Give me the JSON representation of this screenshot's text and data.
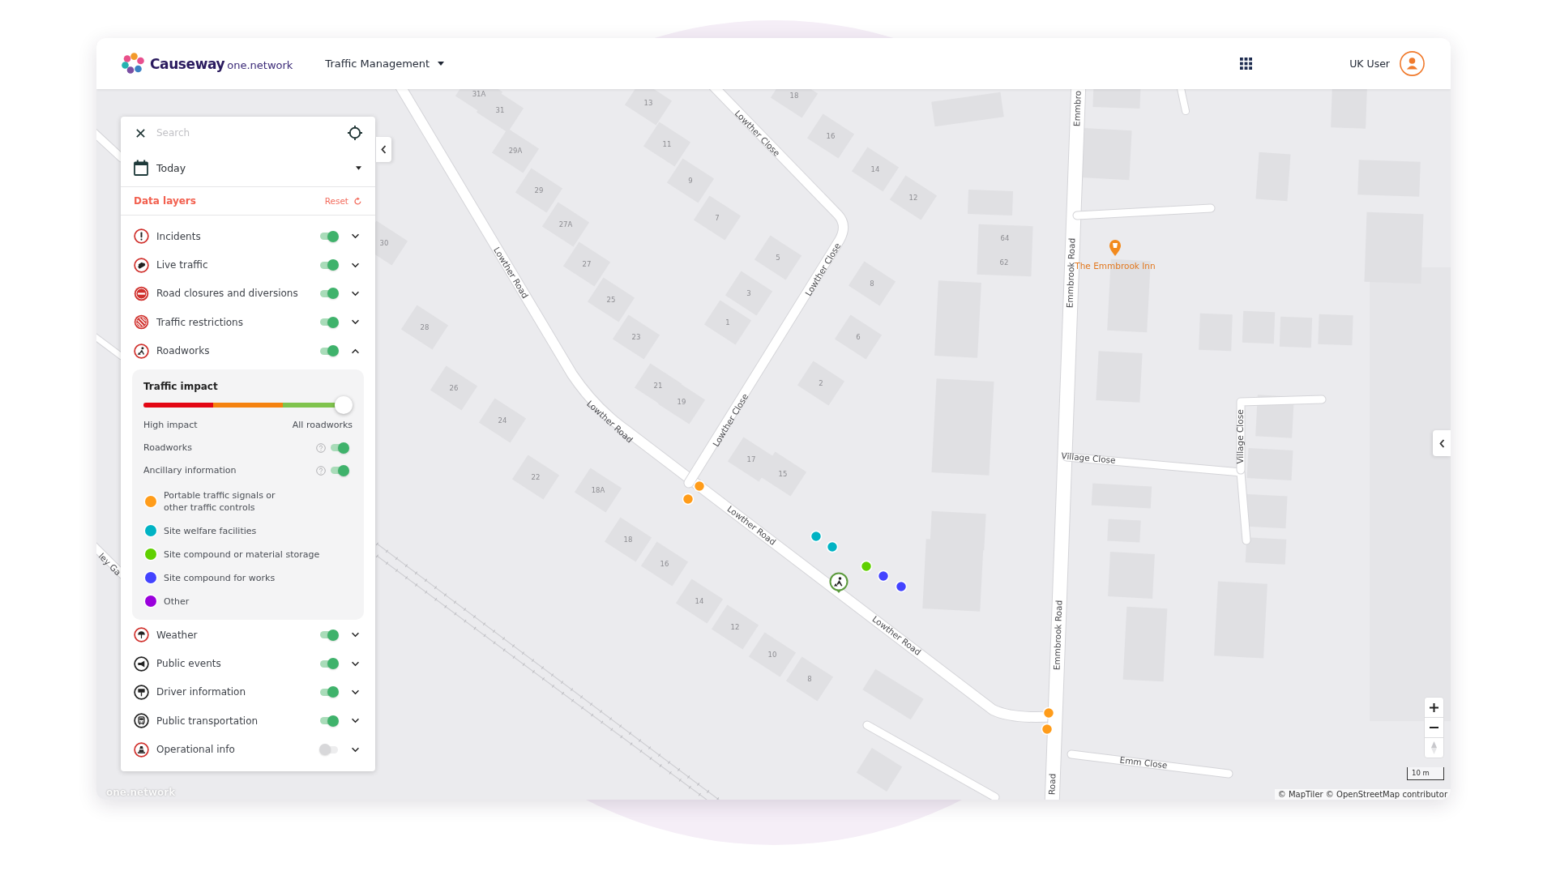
{
  "header": {
    "logo": {
      "brand": "Causeway",
      "suffix": "one.network"
    },
    "module_menu": {
      "label": "Traffic Management"
    },
    "user": {
      "name": "UK User"
    }
  },
  "panel": {
    "search": {
      "placeholder": "Search"
    },
    "date": {
      "value": "Today"
    },
    "section": {
      "title": "Data layers",
      "reset": "Reset"
    },
    "layers": [
      {
        "label": "Incidents",
        "on": true,
        "expanded": false
      },
      {
        "label": "Live traffic",
        "on": true,
        "expanded": false
      },
      {
        "label": "Road closures and diversions",
        "on": true,
        "expanded": false
      },
      {
        "label": "Traffic restrictions",
        "on": true,
        "expanded": false
      },
      {
        "label": "Roadworks",
        "on": true,
        "expanded": true,
        "details": {
          "title": "Traffic impact",
          "level": 1,
          "min_label": "High impact",
          "max_label": "All roadworks",
          "toggles": [
            {
              "label": "Roadworks",
              "on": true
            },
            {
              "label": "Ancillary information",
              "on": true
            }
          ],
          "legend": [
            {
              "label": "Portable traffic signals or\nother traffic controls",
              "color": "#ff9c1a"
            },
            {
              "label": "Site welfare facilities",
              "color": "#00b3c4"
            },
            {
              "label": "Site compound or material storage",
              "color": "#5fd000"
            },
            {
              "label": "Site compound for works",
              "color": "#4343ff"
            },
            {
              "label": "Other",
              "color": "#9a00dc"
            }
          ]
        }
      },
      {
        "label": "Weather",
        "on": true,
        "expanded": false
      },
      {
        "label": "Public events",
        "on": true,
        "expanded": false
      },
      {
        "label": "Driver information",
        "on": true,
        "expanded": false
      },
      {
        "label": "Public transportation",
        "on": true,
        "expanded": false
      },
      {
        "label": "Operational info",
        "on": false,
        "expanded": false
      }
    ]
  },
  "map": {
    "street_labels": [
      "Lowther Road",
      "Lowther Road",
      "Lowther Road",
      "Lowther Road",
      "Lowther Close",
      "Lowther Close",
      "Lowther Close",
      "Emmbro",
      "Emmbrook Road",
      "Village Close",
      "Village Close",
      "Emmbrook Road",
      "Emm Close",
      "Road",
      "ley Ga"
    ],
    "house_numbers": [
      "31A",
      "31",
      "29A",
      "29",
      "27A",
      "27",
      "25",
      "23",
      "21",
      "19",
      "13",
      "11",
      "9",
      "7",
      "5",
      "3",
      "1",
      "18",
      "16",
      "14",
      "12",
      "8",
      "6",
      "2",
      "30",
      "28",
      "26",
      "24",
      "22",
      "18A",
      "18",
      "16",
      "14",
      "12",
      "10",
      "8",
      "17",
      "15",
      "64",
      "62"
    ],
    "place": {
      "label": "The Emmbrook Inn"
    },
    "markers": [
      {
        "color": "#ff9c1a"
      },
      {
        "color": "#ff9c1a"
      },
      {
        "color": "#00b3c4"
      },
      {
        "color": "#00b3c4"
      },
      {
        "color": "#5fd000"
      },
      {
        "color": "#4343ff"
      },
      {
        "color": "#4343ff"
      },
      {
        "color": "#ff9c1a"
      },
      {
        "color": "#ff9c1a"
      }
    ],
    "scale": "10 m",
    "attribution": "© MapTiler © OpenStreetMap contributor",
    "logo": "one.network"
  }
}
